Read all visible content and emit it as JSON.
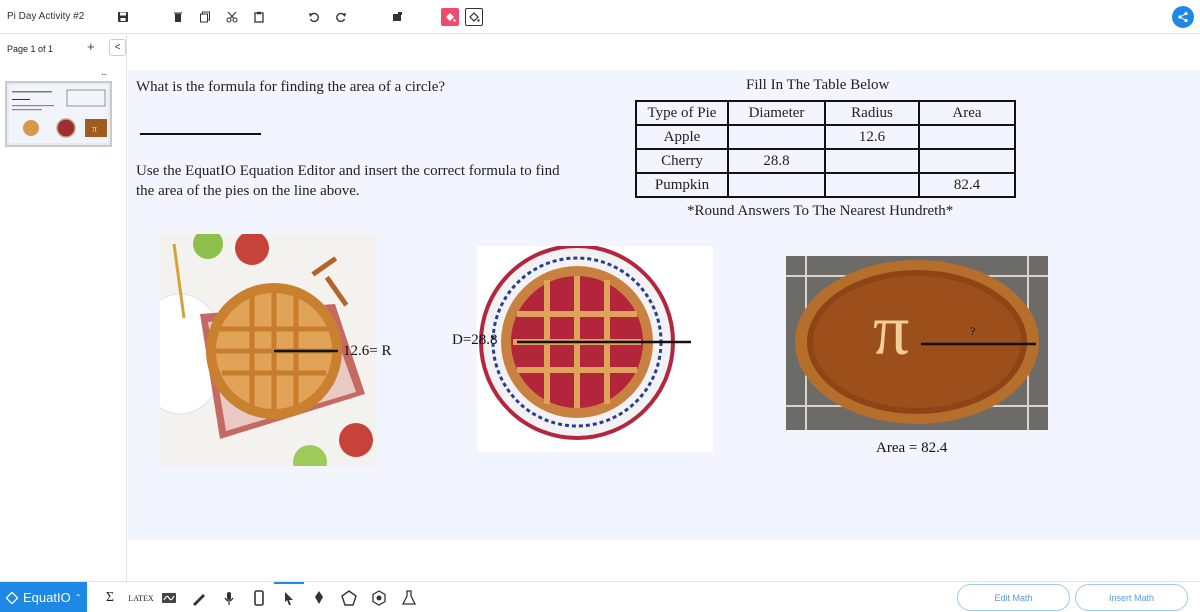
{
  "app": {
    "doc_title": "Pi Day Activity #2"
  },
  "sidebar": {
    "page_label": "Page 1 of 1",
    "add_label": "+",
    "collapse_label": "<",
    "menu_label": "..."
  },
  "canvas": {
    "question1": "What is the formula for finding the area of a circle?",
    "question2": "Use the EquatIO Equation Editor and insert the correct formula to find the area of the pies on the line above.",
    "table_title": "Fill In The Table Below",
    "table": {
      "headers": [
        "Type of Pie",
        "Diameter",
        "Radius",
        "Area"
      ],
      "rows": [
        [
          "Apple",
          "",
          "12.6",
          ""
        ],
        [
          "Cherry",
          "28.8",
          "",
          ""
        ],
        [
          "Pumpkin",
          "",
          "",
          "82.4"
        ]
      ]
    },
    "table_note": "*Round Answers To The Nearest Hundreth*",
    "apple_label": "12.6= R",
    "cherry_label": "D=28.8",
    "pumpkin_question": "?",
    "pumpkin_area_label": "Area  =  82.4",
    "pi_symbol": "π"
  },
  "bottombar": {
    "brand": "EquatIO",
    "latex_label": "LATEX",
    "edit_math": "Edit Math",
    "insert_math": "Insert Math"
  },
  "colors": {
    "accent": "#1e88e5",
    "canvas_bg": "#f2f5fd",
    "paint_pink": "#ef4b6c"
  }
}
